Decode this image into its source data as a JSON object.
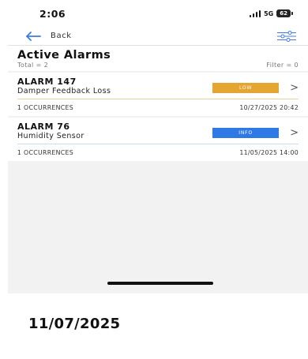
{
  "status_bar": {
    "time": "2:06",
    "network": "5G",
    "battery": "62"
  },
  "nav": {
    "back_label": "Back"
  },
  "header": {
    "title": "Active Alarms",
    "total": "Total = 2",
    "filter": "Filter = 0"
  },
  "alarms": [
    {
      "name": "ALARM 147",
      "description": "Damper Feedback Loss",
      "severity": "LOW",
      "severity_color": "#e5a631",
      "rule_color": "#e9d49a",
      "occurrences": "1 OCCURRENCES",
      "timestamp": "10/27/2025 20:42"
    },
    {
      "name": "ALARM 76",
      "description": "Humidity Sensor",
      "severity": "INFO",
      "severity_color": "#2f79e6",
      "rule_color": "#c9dcf5",
      "occurrences": "1 OCCURRENCES",
      "timestamp": "11/05/2025 14:00"
    }
  ],
  "caption": "11/07/2025",
  "colors": {
    "accent": "#3d7be0"
  },
  "icons": {
    "back": "arrow-left-icon",
    "filter": "filter-sliders-icon",
    "row": "chevron-right-icon"
  }
}
